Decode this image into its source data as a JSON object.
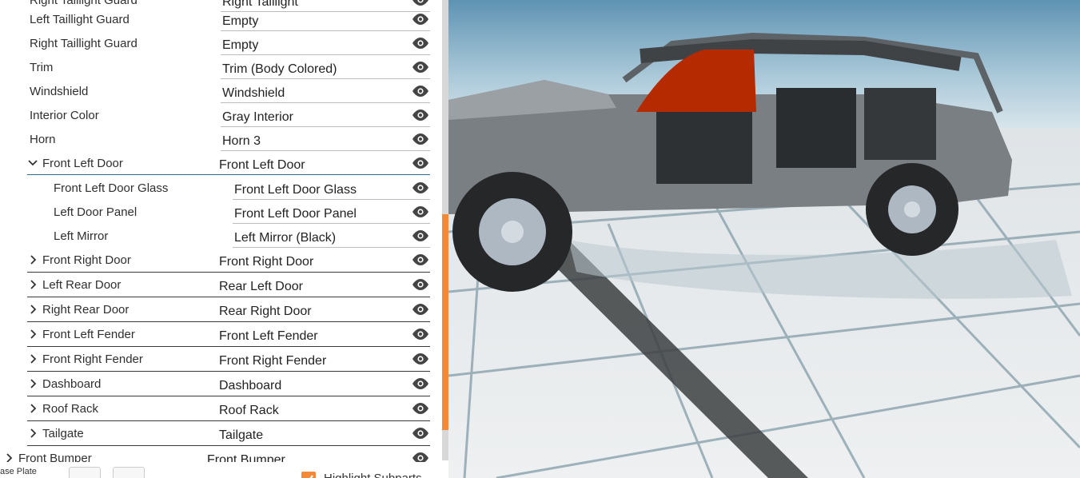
{
  "top_partial": {
    "label": "Right Taillight Guard",
    "value": "Right Taillight"
  },
  "rows": [
    {
      "label": "Left Taillight Guard",
      "value": "Empty"
    },
    {
      "label": "Right Taillight Guard",
      "value": "Empty"
    },
    {
      "label": "Trim",
      "value": "Trim (Body Colored)"
    },
    {
      "label": "Windshield",
      "value": "Windshield"
    },
    {
      "label": "Interior Color",
      "value": "Gray Interior"
    },
    {
      "label": "Horn",
      "value": "Horn 3"
    }
  ],
  "expanded_group": {
    "label": "Front Left Door",
    "value": "Front Left Door",
    "children": [
      {
        "label": "Front Left Door Glass",
        "value": "Front Left Door Glass"
      },
      {
        "label": "Left Door Panel",
        "value": "Front Left Door Panel"
      },
      {
        "label": "Left Mirror",
        "value": "Left Mirror (Black)"
      }
    ]
  },
  "collapsed_groups": [
    {
      "label": "Front Right Door",
      "value": "Front Right Door"
    },
    {
      "label": "Left Rear Door",
      "value": "Rear Left Door"
    },
    {
      "label": "Right Rear Door",
      "value": "Rear Right Door"
    },
    {
      "label": "Front Left Fender",
      "value": "Front Left Fender"
    },
    {
      "label": "Front Right Fender",
      "value": "Front Right Fender"
    },
    {
      "label": "Dashboard",
      "value": "Dashboard"
    },
    {
      "label": "Roof Rack",
      "value": "Roof Rack"
    },
    {
      "label": "Tailgate",
      "value": "Tailgate"
    }
  ],
  "bottom_partial": {
    "label": "Front Bumper",
    "value": "Front Bumper"
  },
  "footer": {
    "license_label": "ase Plate",
    "highlight_label": "Highlight Subparts",
    "highlight_checked": true
  },
  "colors": {
    "accent": "#f28a3c",
    "active_underline": "#2c6a89",
    "highlighted_part": "#b52a00"
  },
  "icons": {
    "visibility": "eye-icon",
    "expand": "chevron-right-icon",
    "collapse": "chevron-down-icon",
    "dropdown": "caret-down-icon"
  }
}
